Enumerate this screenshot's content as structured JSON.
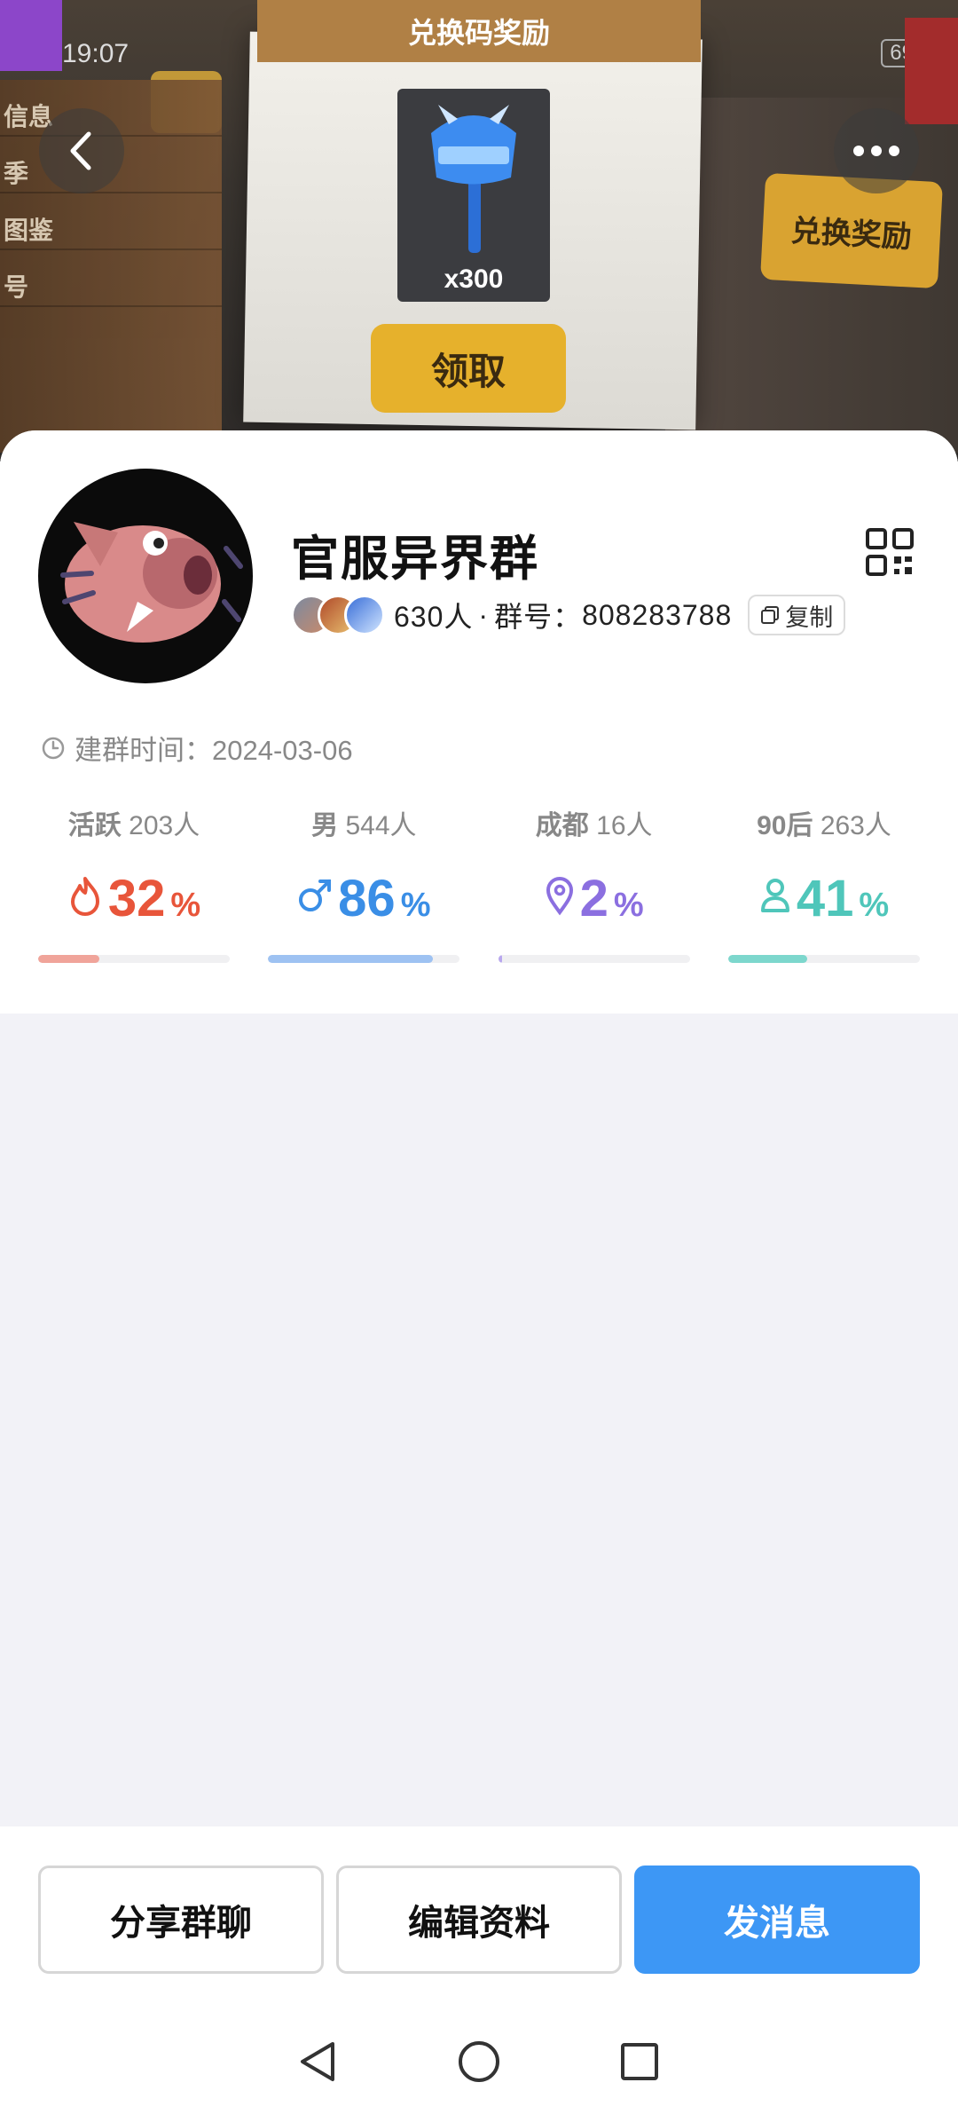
{
  "status_bar": {
    "time": "19:07",
    "battery": "69"
  },
  "background_game": {
    "banner_title": "兑换码奖励",
    "item_count": "x300",
    "claim_label": "领取",
    "redeem_label": "兑换奖励",
    "side_menu": [
      "信息",
      "季",
      "图鉴",
      "号"
    ]
  },
  "group": {
    "name": "官服异界群",
    "member_count": "630人",
    "separator": "·",
    "group_number_label": "群号：",
    "group_number": "808283788",
    "copy_label": "复制",
    "created_label": "建群时间：",
    "created_date": "2024-03-06"
  },
  "stats": [
    {
      "label": "活跃",
      "count": "203人",
      "value": "32",
      "unit": "%",
      "icon": "flame-icon",
      "color": "#e8553a",
      "bar_color": "#f0a49a",
      "fraction": 0.32
    },
    {
      "label": "男",
      "count": "544人",
      "value": "86",
      "unit": "%",
      "icon": "male-icon",
      "color": "#3a8ee6",
      "bar_color": "#9ec2f2",
      "fraction": 0.86
    },
    {
      "label": "成都",
      "count": "16人",
      "value": "2",
      "unit": "%",
      "icon": "location-pin-icon",
      "color": "#8b6fe0",
      "bar_color": "#b9a8ee",
      "fraction": 0.02
    },
    {
      "label": "90后",
      "count": "263人",
      "value": "41",
      "unit": "%",
      "icon": "person-icon",
      "color": "#4fc6ba",
      "bar_color": "#7dd7cd",
      "fraction": 0.41
    }
  ],
  "actions": {
    "share": "分享群聊",
    "edit": "编辑资料",
    "message": "发消息"
  },
  "colors": {
    "primary": "#3d97f5"
  }
}
